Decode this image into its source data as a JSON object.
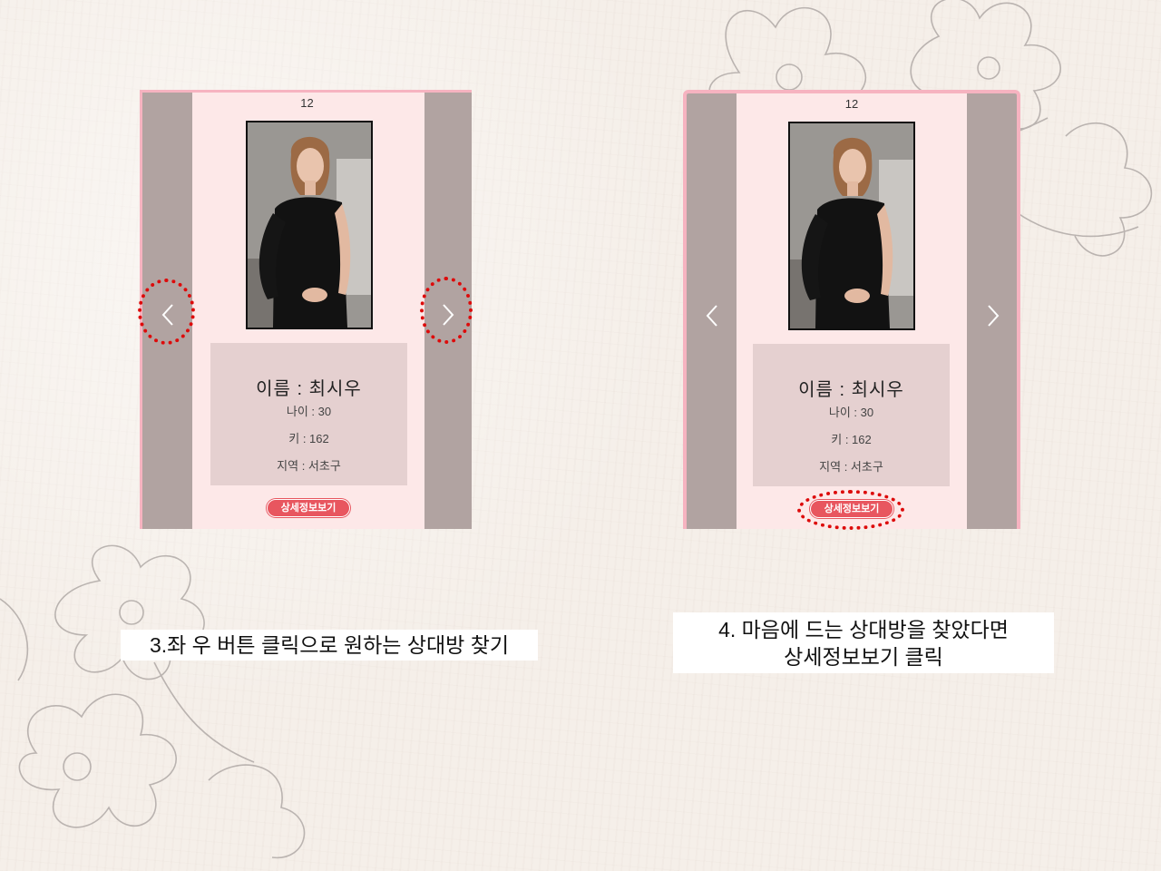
{
  "colors": {
    "accent": "#e8565f",
    "highlight": "#dd0b0b",
    "phone_bg": "#fde8e8",
    "side_panel": "#b1a3a1",
    "info_bg": "#e5d0d0",
    "frame_border": "#f6b3c0"
  },
  "left_screen": {
    "page_number": "12",
    "prev_icon": "chevron-left-icon",
    "next_icon": "chevron-right-icon",
    "profile": {
      "name": "이름 : 최시우",
      "age": "나이 : 30",
      "height": "키 : 162",
      "region": "지역 : 서초구"
    },
    "detail_button_label": "상세정보보기"
  },
  "right_screen": {
    "page_number": "12",
    "prev_icon": "chevron-left-icon",
    "next_icon": "chevron-right-icon",
    "profile": {
      "name": "이름 : 최시우",
      "age": "나이 : 30",
      "height": "키 : 162",
      "region": "지역 : 서초구"
    },
    "detail_button_label": "상세정보보기"
  },
  "captions": {
    "step3": "3.좌 우 버튼 클릭으로 원하는 상대방 찾기",
    "step4_line1": "4. 마음에 드는 상대방을 찾았다면",
    "step4_line2": "상세정보보기 클릭"
  }
}
